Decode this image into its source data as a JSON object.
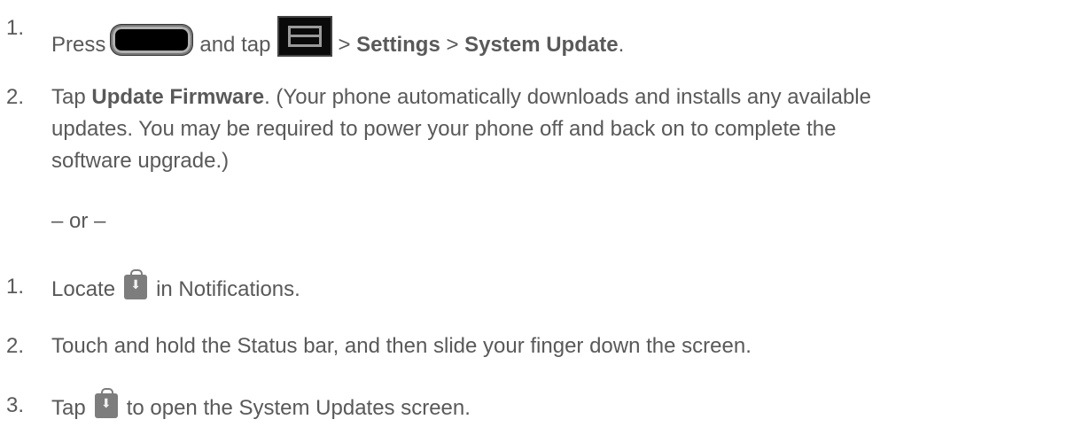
{
  "steps_a": [
    {
      "number": "1.",
      "press": "Press",
      "and_tap": "and tap",
      "sep1": ">",
      "settings": "Settings",
      "sep2": ">",
      "system_update": "System Update",
      "period": "."
    },
    {
      "number": "2.",
      "tap": "Tap",
      "update_firmware": "Update Firmware",
      "line1_rest": ". (Your phone automatically downloads and installs any available",
      "line2": "updates. You may be required to power your phone off and back on to complete the",
      "line3": "software upgrade.)"
    }
  ],
  "or_text": "– or –",
  "steps_b": [
    {
      "number": "1.",
      "before": "Locate",
      "after": "in Notifications."
    },
    {
      "number": "2.",
      "text": "Touch and hold the Status bar, and then slide your finger down the screen."
    },
    {
      "number": "3.",
      "before": "Tap",
      "after": "to open the System Updates screen."
    }
  ],
  "icons": {
    "home_key": "home-key-icon",
    "menu_key": "menu-key-icon",
    "download": "system-update-download-icon"
  }
}
